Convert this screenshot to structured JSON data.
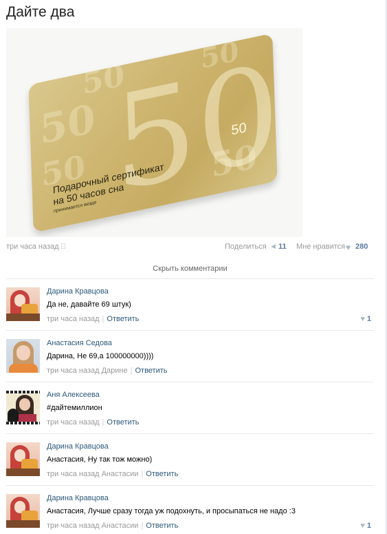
{
  "post": {
    "title": "Дайте два",
    "image": {
      "card_line1": "Подарочный сертификат",
      "card_line2": "на 50 часов сна",
      "card_small": "принимается везде",
      "card_number": "50"
    },
    "time": "три часа назад",
    "platform_icon": "apple-icon",
    "share_label": "Поделиться",
    "share_count": "11",
    "like_label": "Мне нравится",
    "like_count": "280"
  },
  "comments_toggle": "Скрыть комментарии",
  "comments": [
    {
      "author": "Дарина Кравцова",
      "text": "Да не, давайте 69 штук)",
      "time": "три часа назад",
      "reply_label": "Ответить",
      "likes": "1",
      "avatar": "darina"
    },
    {
      "author": "Анастасия Седова",
      "text": "Дарина, Не 69,а 100000000))))",
      "time": "три часа назад Дарине",
      "reply_label": "Ответить",
      "likes": "",
      "avatar": "anastasia"
    },
    {
      "author": "Аня Алексеева",
      "text": "#дайтемиллион",
      "time": "три часа назад",
      "reply_label": "Ответить",
      "likes": "",
      "avatar": "anya"
    },
    {
      "author": "Дарина Кравцова",
      "text": "Анастасия, Ну так тож можно)",
      "time": "три часа назад Анастасии",
      "reply_label": "Ответить",
      "likes": "",
      "avatar": "darina"
    },
    {
      "author": "Дарина Кравцова",
      "text": "Анастасия, Лучше сразу тогда уж подохнуть, и просыпаться не надо :3",
      "time": "три часа назад Анастасии",
      "reply_label": "Ответить",
      "likes": "1",
      "avatar": "darina"
    }
  ],
  "colors": {
    "link": "#2b587a",
    "muted": "#999999",
    "count": "#5b7aa0",
    "card_gold": "#cdb46e"
  }
}
